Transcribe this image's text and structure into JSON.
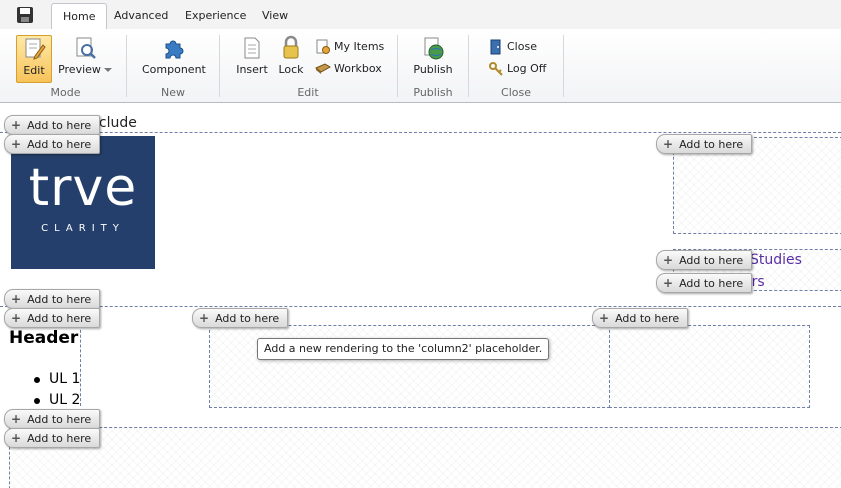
{
  "ribbon": {
    "tabs": [
      {
        "label": "Home",
        "active": true
      },
      {
        "label": "Advanced",
        "active": false
      },
      {
        "label": "Experience",
        "active": false
      },
      {
        "label": "View",
        "active": false
      }
    ],
    "groups": {
      "mode": {
        "label": "Mode",
        "edit": "Edit",
        "preview": "Preview"
      },
      "new": {
        "label": "New",
        "component": "Component"
      },
      "edit": {
        "label": "Edit",
        "insert": "Insert",
        "lock": "Lock",
        "my_items": "My Items",
        "workbox": "Workbox"
      },
      "publish": {
        "label": "Publish",
        "publish": "Publish"
      },
      "close": {
        "label": "Close",
        "close": "Close",
        "logoff": "Log Off"
      }
    }
  },
  "page": {
    "add_label": "Add to here",
    "include_text": "nclude",
    "logo": {
      "word": "trve",
      "sub": "CLARITY"
    },
    "links": [
      "Studies",
      "ers"
    ],
    "header": "Header",
    "list": [
      "UL 1",
      "UL 2"
    ],
    "tooltip": "Add a new rendering to the 'column2' placeholder."
  },
  "colors": {
    "accent": "#f7c35a",
    "placeholder_border": "#6f7fa6",
    "logo_bg": "#243f6b",
    "link": "#5a2ea6"
  }
}
